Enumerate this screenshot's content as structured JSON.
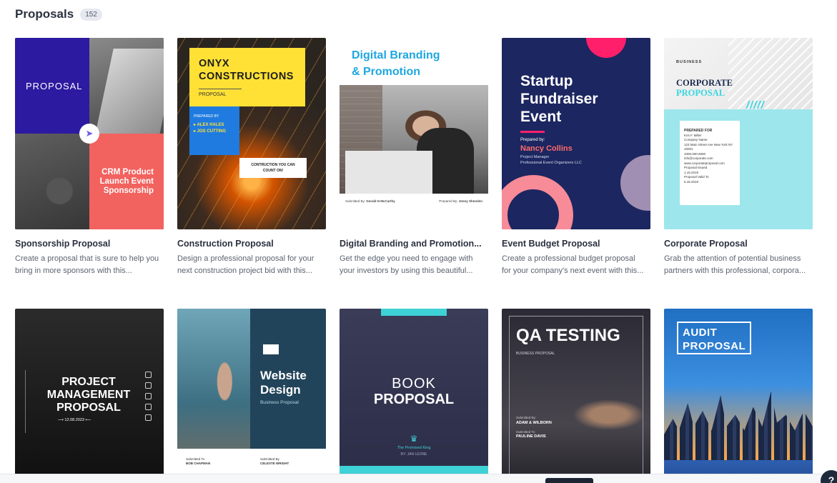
{
  "header": {
    "title": "Proposals",
    "count": "152"
  },
  "cards": [
    {
      "title": "Sponsorship Proposal",
      "desc": [
        "Create a proposal that is sure to help you",
        "bring in more sponsors with this..."
      ],
      "thumb": {
        "label": "PROPOSAL",
        "sub": "CRM Product Launch Event Sponsorship"
      }
    },
    {
      "title": "Construction Proposal",
      "desc": [
        "Design a professional proposal for your",
        "next construction project bid with this..."
      ],
      "thumb": {
        "name_line1": "ONYX",
        "name_line2": "CONSTRUCTIONS",
        "label": "PROPOSAL",
        "prepared_by": "PREPARED BY",
        "person1": "▸ ALEX HALES",
        "person2": "▸ JOS CUTTING",
        "tagline": "CONTRUCTION YOU CAN COUNT ON!"
      }
    },
    {
      "title": "Digital Branding and Promotion...",
      "desc": [
        "Get the edge you need to engage with",
        "your investors by using this beautiful..."
      ],
      "thumb": {
        "line1": "Digital Branding",
        "line2": "& Promotion",
        "submitted_by": "Submitted By:",
        "person1": "Gerald H McCarthy",
        "prepared_by": "Prepared By:",
        "person2": "Jenny Shmolen"
      }
    },
    {
      "title": "Event Budget Proposal",
      "desc": [
        "Create a professional budget proposal",
        "for your company's next event with this..."
      ],
      "thumb": {
        "line1": "Startup",
        "line2": "Fundraiser",
        "line3": "Event",
        "prepared_by": "Prepared by:",
        "name": "Nancy Collins",
        "role1": "Project Manager",
        "role2": "Professional Event Organizers LLC"
      }
    },
    {
      "title": "Corporate Proposal",
      "desc": [
        "Grab the attention of potential business",
        "partners with this professional, corpora..."
      ],
      "thumb": {
        "business": "BUSINESS",
        "line1": "CORPORATE",
        "line2": "PROPOSAL",
        "slashes": "/////",
        "prepared_for": "PREPARED FOR",
        "name": "Kris F. Miller",
        "company": "Company Name",
        "address": "123 Main Street Ave New York NY 10001",
        "phone": "1000.000.0000",
        "email": "info@corporate.com",
        "website": "www.corporateproposal.com",
        "issued_label": "Proposal Issued",
        "issued": "1.15.2019",
        "valid_label": "Proposal Valid To",
        "valid": "6.15.2019"
      }
    },
    {
      "title": "",
      "desc": [],
      "thumb": {
        "line1": "PROJECT",
        "line2": "MANAGEMENT",
        "line3": "PROPOSAL",
        "date": "⟶ 12.08.2023 ⟵"
      }
    },
    {
      "title": "",
      "desc": [],
      "thumb": {
        "line1": "Website",
        "line2": "Design",
        "sub": "Business Proposal",
        "submitted_to": "Submitted To",
        "person1": "BOB CHAPMAN",
        "submitted_by": "Submitted By",
        "person2": "CELESTE WRIGHT"
      }
    },
    {
      "title": "",
      "desc": [],
      "thumb": {
        "line1": "BOOK",
        "line2": "PROPOSAL",
        "brand": "The Promised King",
        "author": "BY: JAN LEONE"
      }
    },
    {
      "title": "",
      "desc": [],
      "thumb": {
        "line1": "QA TESTING",
        "sub": "BUSINESS PROPOSAL",
        "submitted_by": "Submitted By:",
        "company": "ADAM & WILBORN",
        "submitted_to": "Submitted To:",
        "person": "PAULINE DAVIS"
      }
    },
    {
      "title": "",
      "desc": [],
      "thumb": {
        "line1": "AUDIT",
        "line2": "PROPOSAL"
      }
    }
  ],
  "help": {
    "label": "?"
  },
  "icons": {
    "rocket": "rocket-icon",
    "crown": "crown-icon",
    "help": "help-icon"
  },
  "colors": {
    "accent": "#1ea7e0",
    "pink": "#ff1f6b",
    "teal": "#3ed1d6",
    "yellow": "#ffe135",
    "navy": "#1c2660"
  }
}
